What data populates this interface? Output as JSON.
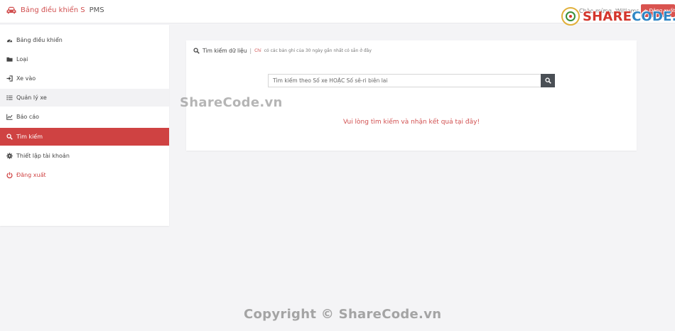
{
  "header": {
    "brand_main": "Bảng điều khiển S",
    "brand_suffix": "PMS",
    "greeting": "Chào mừng, Williams",
    "logout_label": "Đăng xuất",
    "watermark_logo_share": "SHARE",
    "watermark_logo_rest": "CODE.vn"
  },
  "sidebar": {
    "items": [
      {
        "label": "Bảng điều khiển",
        "icon": "dashboard-icon"
      },
      {
        "label": "Loại",
        "icon": "folder-icon"
      },
      {
        "label": "Xe vào",
        "icon": "sign-in-icon"
      },
      {
        "label": "Quản lý xe",
        "icon": "list-icon"
      },
      {
        "label": "Báo cáo",
        "icon": "line-chart-icon"
      },
      {
        "label": "Tìm kiếm",
        "icon": "search-icon"
      },
      {
        "label": "Thiết lập tài khoản",
        "icon": "gear-icon"
      },
      {
        "label": "Đăng xuất",
        "icon": "power-icon"
      }
    ],
    "active_index": 5
  },
  "panel": {
    "heading": "Tìm kiếm dữ liệu",
    "separator": "|",
    "note_strong": "Chỉ",
    "note": "có các bản ghi của 30 ngày gần nhất có sẵn ở đây",
    "search_placeholder": "Tìm kiếm theo Số xe HOẶC Số sê-ri biên lai",
    "result_message": "Vui lòng tìm kiếm và nhận kết quả tại đây!"
  },
  "watermarks": {
    "middle": "ShareCode.vn",
    "bottom": "Copyright © ShareCode.vn"
  },
  "colors": {
    "accent": "#cf4242",
    "search_button": "#4a4f55",
    "background": "#f4f4f6"
  }
}
